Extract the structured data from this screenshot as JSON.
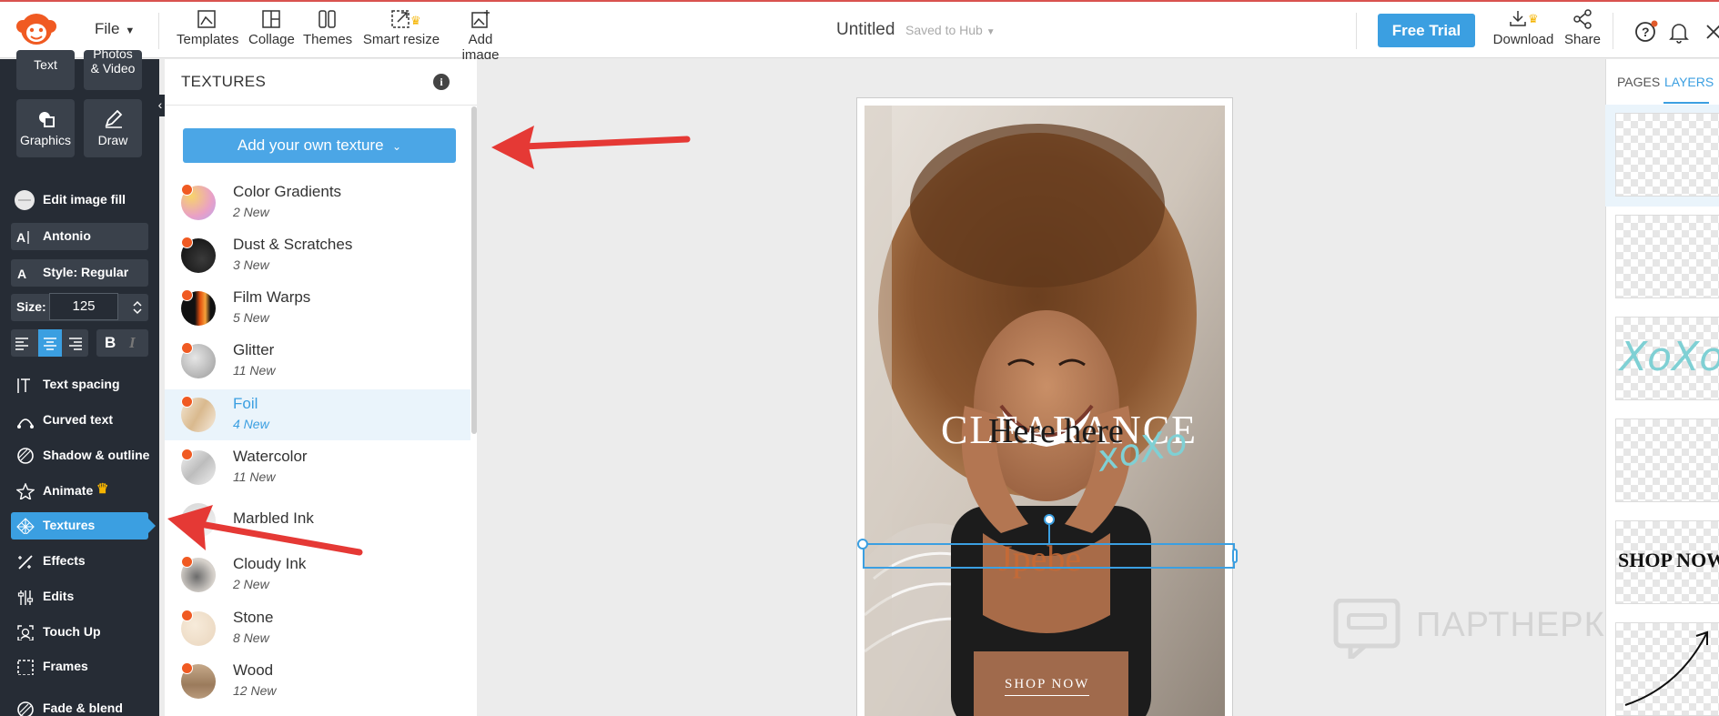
{
  "topbar": {
    "file_label": "File",
    "tools": [
      {
        "label": "Templates",
        "icon": "templates-icon"
      },
      {
        "label": "Collage",
        "icon": "collage-icon"
      },
      {
        "label": "Themes",
        "icon": "themes-icon"
      },
      {
        "label": "Smart resize",
        "icon": "smart-resize-icon"
      },
      {
        "label": "Add image",
        "icon": "add-image-icon"
      }
    ],
    "doc_title": "Untitled",
    "saved_status": "Saved to Hub",
    "free_trial": "Free Trial",
    "download": "Download",
    "share": "Share",
    "accent_color": "#3b9fe1"
  },
  "leftbar": {
    "tiles": {
      "text": "Text",
      "photos": "Photos",
      "video": "& Video",
      "graphics": "Graphics",
      "draw": "Draw"
    },
    "edit_image_fill": "Edit image fill",
    "font": "Antonio",
    "style": "Style: Regular",
    "size_label": "Size:",
    "size_value": "125",
    "bold": "B",
    "italic": "I",
    "items": [
      {
        "label": "Text spacing",
        "icon": "text-spacing-icon"
      },
      {
        "label": "Curved text",
        "icon": "curved-text-icon"
      },
      {
        "label": "Shadow & outline",
        "icon": "shadow-outline-icon"
      },
      {
        "label": "Animate",
        "icon": "animate-icon"
      },
      {
        "label": "Textures",
        "icon": "textures-icon"
      },
      {
        "label": "Effects",
        "icon": "effects-icon"
      },
      {
        "label": "Edits",
        "icon": "edits-icon"
      },
      {
        "label": "Touch Up",
        "icon": "touch-up-icon"
      },
      {
        "label": "Frames",
        "icon": "frames-icon"
      },
      {
        "label": "Fade & blend",
        "icon": "fade-blend-icon"
      }
    ]
  },
  "panel": {
    "title": "TEXTURES",
    "add_button": "Add your own texture",
    "textures": [
      {
        "name": "Color Gradients",
        "new": "2 New"
      },
      {
        "name": "Dust & Scratches",
        "new": "3 New"
      },
      {
        "name": "Film Warps",
        "new": "5 New"
      },
      {
        "name": "Glitter",
        "new": "11 New"
      },
      {
        "name": "Foil",
        "new": "4 New"
      },
      {
        "name": "Watercolor",
        "new": "11 New"
      },
      {
        "name": "Marbled Ink",
        "new": ""
      },
      {
        "name": "Cloudy Ink",
        "new": "2 New"
      },
      {
        "name": "Stone",
        "new": "8 New"
      },
      {
        "name": "Wood",
        "new": "12 New"
      }
    ]
  },
  "canvas": {
    "headline": "CLEARANCE",
    "overlay": "Here here",
    "xoxo": "xoXo",
    "selected_text": "Jpebe",
    "shop_now": "SHOP NOW"
  },
  "watermark": "ПАРТНЕРКИН",
  "layers_panel": {
    "tab_pages": "PAGES",
    "tab_layers": "LAYERS",
    "layer_xoxo": "XoXo",
    "layer_shop": "SHOP NOW"
  }
}
